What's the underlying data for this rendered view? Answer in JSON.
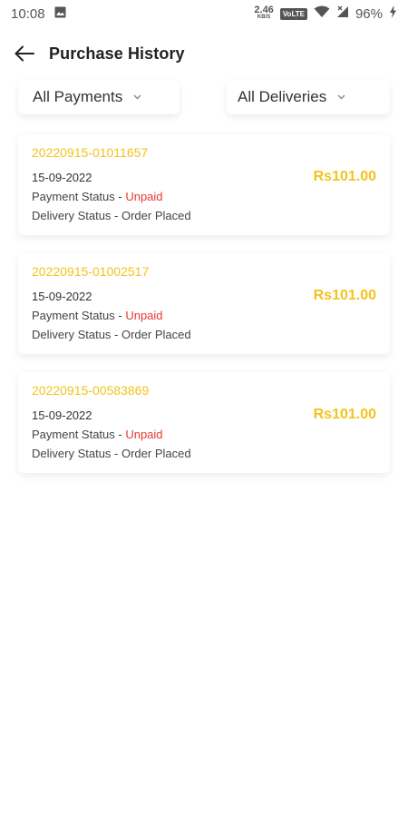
{
  "status_bar": {
    "time": "10:08",
    "net_speed": "2.46",
    "net_unit": "KB/S",
    "volte": "VoLTE",
    "battery": "96%"
  },
  "app_bar": {
    "title": "Purchase History"
  },
  "filters": {
    "payments": "All Payments",
    "deliveries": "All Deliveries"
  },
  "labels": {
    "payment_status": "Payment Status - ",
    "delivery_status": "Delivery Status - "
  },
  "orders": [
    {
      "id": "20220915-01011657",
      "date": "15-09-2022",
      "payment_status": "Unpaid",
      "delivery_status": "Order Placed",
      "amount": "Rs101.00"
    },
    {
      "id": "20220915-01002517",
      "date": "15-09-2022",
      "payment_status": "Unpaid",
      "delivery_status": "Order Placed",
      "amount": "Rs101.00"
    },
    {
      "id": "20220915-00583869",
      "date": "15-09-2022",
      "payment_status": "Unpaid",
      "delivery_status": "Order Placed",
      "amount": "Rs101.00"
    }
  ],
  "colors": {
    "accent": "#f3c31c",
    "unpaid": "#e53935",
    "text": "#333333"
  },
  "icons": {
    "back": "arrow-left-icon",
    "dropdown": "chevron-down-icon",
    "gallery": "image-icon",
    "wifi": "wifi-icon",
    "signal": "signal-icon",
    "battery": "battery-charging-icon"
  }
}
